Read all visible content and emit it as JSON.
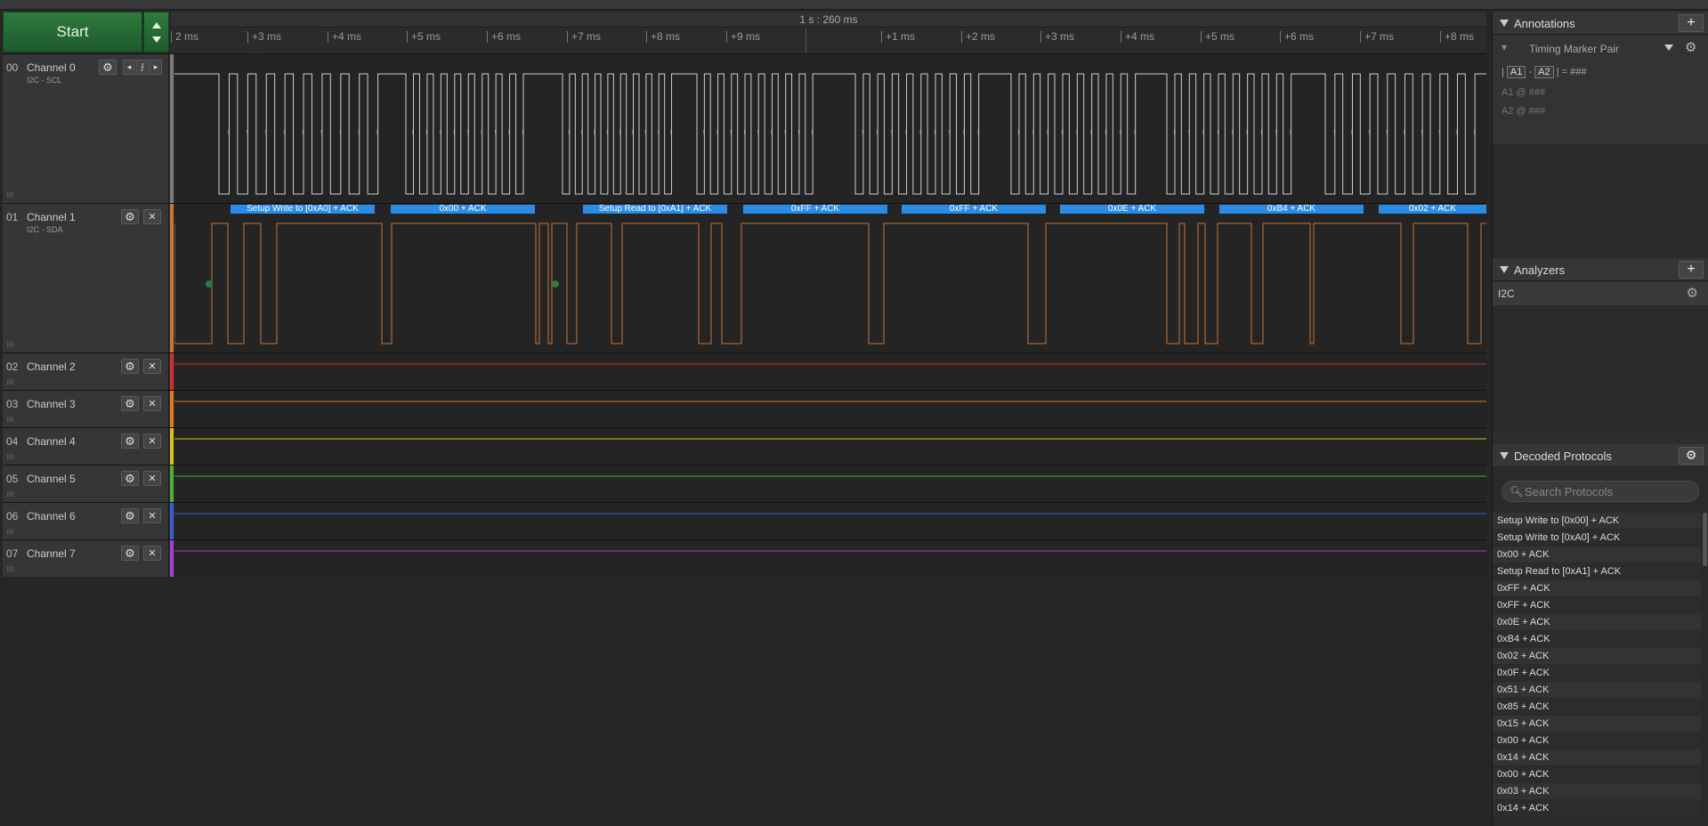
{
  "start_button": {
    "label": "Start"
  },
  "timeline": {
    "center_label": "1 s : 260 ms",
    "ticks": [
      "2 ms",
      "+3 ms",
      "+4 ms",
      "+5 ms",
      "+6 ms",
      "+7 ms",
      "+8 ms",
      "+9 ms",
      "+1 ms",
      "+2 ms",
      "+3 ms",
      "+4 ms",
      "+5 ms",
      "+6 ms",
      "+7 ms",
      "+8 ms"
    ]
  },
  "channels": [
    {
      "num": "00",
      "name": "Channel 0",
      "sub": "I2C - SCL",
      "color": "#7a7a7a"
    },
    {
      "num": "01",
      "name": "Channel 1",
      "sub": "I2C - SDA",
      "color": "#c87533"
    },
    {
      "num": "02",
      "name": "Channel 2",
      "sub": "",
      "color": "#d03030"
    },
    {
      "num": "03",
      "name": "Channel 3",
      "sub": "",
      "color": "#e07a20"
    },
    {
      "num": "04",
      "name": "Channel 4",
      "sub": "",
      "color": "#d8c020"
    },
    {
      "num": "05",
      "name": "Channel 5",
      "sub": "",
      "color": "#4caf3a"
    },
    {
      "num": "06",
      "name": "Channel 6",
      "sub": "",
      "color": "#3a5fd0"
    },
    {
      "num": "07",
      "name": "Channel 7",
      "sub": "",
      "color": "#a040d0"
    }
  ],
  "decode_bars": [
    "Setup Write to [0xA0] + ACK",
    "0x00 + ACK",
    "Setup Read to [0xA1] + ACK",
    "0xFF + ACK",
    "0xFF + ACK",
    "0x0E + ACK",
    "0xB4 + ACK",
    "0x02 + ACK"
  ],
  "annotations": {
    "title": "Annotations",
    "item_title": "Timing Marker Pair",
    "a1": "A1",
    "a2": "A2",
    "diff_value": "= ###",
    "a1_line": "A1  @  ###",
    "a2_line": "A2  @  ###"
  },
  "analyzers": {
    "title": "Analyzers",
    "items": [
      "I2C"
    ]
  },
  "decoded": {
    "title": "Decoded Protocols",
    "search_placeholder": "Search Protocols",
    "items": [
      "Setup Write to [0x00] + ACK",
      "Setup Write to [0xA0] + ACK",
      "0x00 + ACK",
      "Setup Read to [0xA1] + ACK",
      "0xFF + ACK",
      "0xFF + ACK",
      "0x0E + ACK",
      "0xB4 + ACK",
      "0x02 + ACK",
      "0x0F + ACK",
      "0x51 + ACK",
      "0x85 + ACK",
      "0x15 + ACK",
      "0x00 + ACK",
      "0x14 + ACK",
      "0x00 + ACK",
      "0x03 + ACK",
      "0x14 + ACK"
    ]
  }
}
